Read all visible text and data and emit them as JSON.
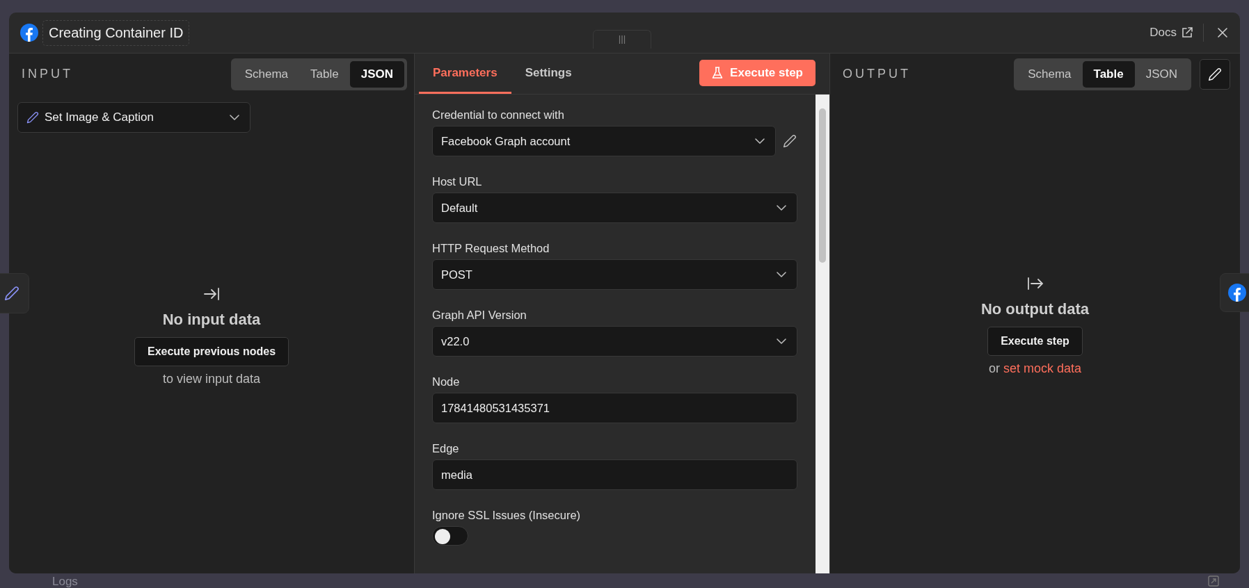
{
  "window": {
    "title": "Creating Container ID",
    "docs_link": "Docs"
  },
  "input_panel": {
    "heading": "INPUT",
    "view_tabs": [
      {
        "label": "Schema",
        "selected": false
      },
      {
        "label": "Table",
        "selected": false
      },
      {
        "label": "JSON",
        "selected": true
      }
    ],
    "node_select": {
      "value": "Set Image & Caption"
    },
    "empty": {
      "title": "No input data",
      "button": "Execute previous nodes",
      "hint": "to view input data"
    }
  },
  "parameters_panel": {
    "tabs": [
      {
        "label": "Parameters",
        "selected": true
      },
      {
        "label": "Settings",
        "selected": false
      }
    ],
    "execute_button": "Execute step",
    "fields": [
      {
        "kind": "credential",
        "label": "Credential to connect with",
        "value": "Facebook Graph account"
      },
      {
        "kind": "select",
        "label": "Host URL",
        "value": "Default"
      },
      {
        "kind": "select",
        "label": "HTTP Request Method",
        "value": "POST"
      },
      {
        "kind": "select",
        "label": "Graph API Version",
        "value": "v22.0"
      },
      {
        "kind": "text",
        "label": "Node",
        "value": "17841480531435371"
      },
      {
        "kind": "text",
        "label": "Edge",
        "value": "media"
      },
      {
        "kind": "toggle",
        "label": "Ignore SSL Issues (Insecure)",
        "on": false
      }
    ]
  },
  "output_panel": {
    "heading": "OUTPUT",
    "view_tabs": [
      {
        "label": "Schema",
        "selected": false
      },
      {
        "label": "Table",
        "selected": true
      },
      {
        "label": "JSON",
        "selected": false
      }
    ],
    "empty": {
      "title": "No output data",
      "button": "Execute step",
      "hint_prefix": "or",
      "hint_link": "set mock data"
    }
  },
  "bottom_bar": {
    "label": "Logs"
  }
}
